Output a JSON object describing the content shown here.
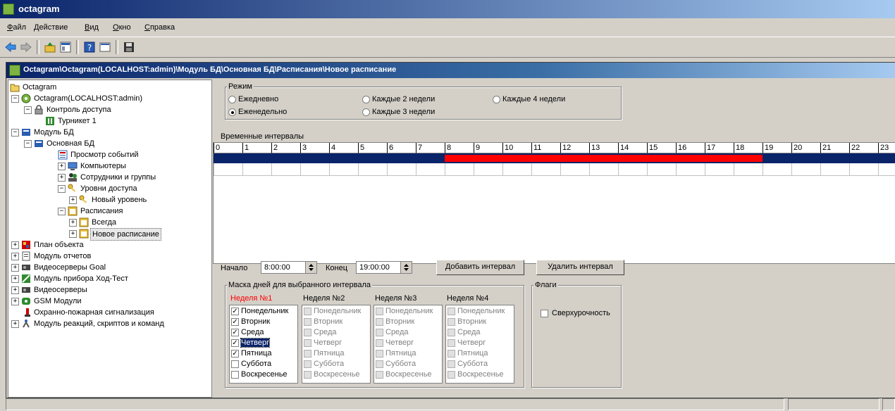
{
  "app": {
    "title": "octagram"
  },
  "menu": [
    "Файл",
    "Действие",
    "Вид",
    "Окно",
    "Справка"
  ],
  "window": {
    "title": "Octagram\\Octagram(LOCALHOST:admin)\\Модуль БД\\Основная БД\\Расписания\\Новое расписание"
  },
  "tree": {
    "root": "Octagram",
    "server": "Octagram(LOCALHOST:admin)",
    "access": "Контроль доступа",
    "turnstile": "Турникет 1",
    "db_module": "Модуль БД",
    "main_db": "Основная БД",
    "events": "Просмотр событий",
    "computers": "Компьютеры",
    "employees": "Сотрудники и группы",
    "levels": "Уровни доступа",
    "new_level": "Новый уровень",
    "schedules": "Расписания",
    "always": "Всегда",
    "new_schedule": "Новое расписание",
    "plan": "План объекта",
    "reports": "Модуль отчетов",
    "goal": "Видеосерверы Goal",
    "hodtest": "Модуль прибора Ход-Тест",
    "videoservers": "Видеосерверы",
    "gsm": "GSM Модули",
    "fire": "Охранно-пожарная сигнализация",
    "reactions": "Модуль реакций, скриптов и команд"
  },
  "mode": {
    "label": "Режим",
    "daily": "Ежедневно",
    "weekly": "Еженедельно",
    "every2": "Каждые 2 недели",
    "every3": "Каждые 3 недели",
    "every4": "Каждые 4 недели",
    "selected": "weekly"
  },
  "intervals": {
    "label": "Временные интервалы",
    "hours": [
      "0",
      "1",
      "2",
      "3",
      "4",
      "5",
      "6",
      "7",
      "8",
      "9",
      "10",
      "11",
      "12",
      "13",
      "14",
      "15",
      "16",
      "17",
      "18",
      "19",
      "20",
      "21",
      "22",
      "23"
    ],
    "interval_start_hour": 8,
    "interval_end_hour": 19
  },
  "controls": {
    "start_label": "Начало",
    "start_value": "8:00:00",
    "end_label": "Конец",
    "end_value": "19:00:00",
    "add_button": "Добавить интервал",
    "delete_button": "Удалить интервал"
  },
  "mask": {
    "label": "Маска дней для выбранного интервала",
    "weeks": [
      "Неделя №1",
      "Неделя №2",
      "Неделя №3",
      "Неделя №4"
    ],
    "days": [
      "Понедельник",
      "Вторник",
      "Среда",
      "Четверг",
      "Пятница",
      "Суббота",
      "Воскресенье"
    ],
    "week1_checked": [
      true,
      true,
      true,
      true,
      true,
      false,
      false
    ]
  },
  "flags": {
    "label": "Флаги",
    "overtime": "Сверхурочность"
  },
  "colors": {
    "title_blue": "#0a246a",
    "interval_red": "#ff0000",
    "week1_red": "#ff0000"
  }
}
